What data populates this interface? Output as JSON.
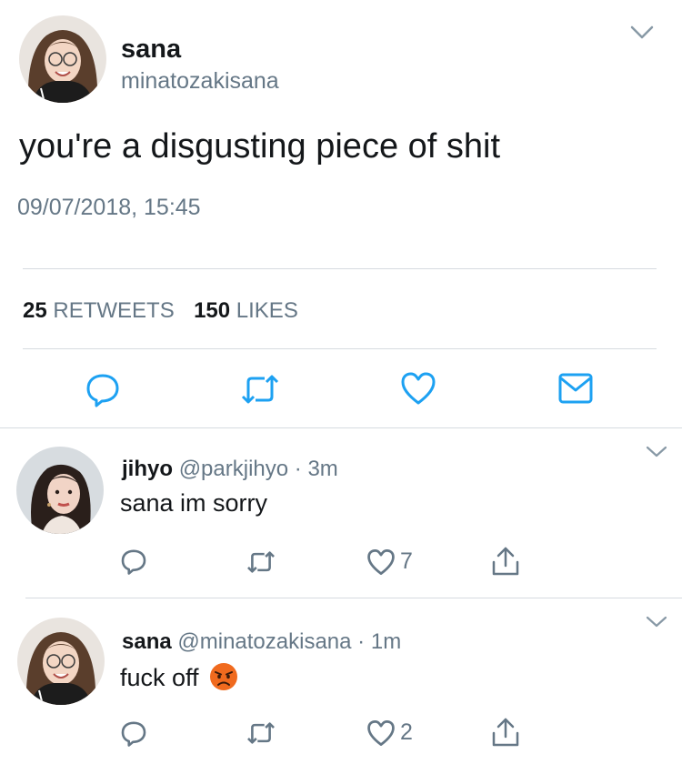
{
  "main_tweet": {
    "display_name": "sana",
    "username": "minatozakisana",
    "text": "you're a disgusting piece of shit",
    "timestamp": "09/07/2018, 15:45",
    "retweets_count": "25",
    "retweets_label": "RETWEETS",
    "likes_count": "150",
    "likes_label": "LIKES"
  },
  "replies": [
    {
      "display_name": "jihyo",
      "handle": "@parkjihyo",
      "separator": "·",
      "time": "3m",
      "text": "sana im sorry",
      "like_count": "7"
    },
    {
      "display_name": "sana",
      "handle": "@minatozakisana",
      "separator": "·",
      "time": "1m",
      "text": "fuck off",
      "emoji": "angry-face",
      "like_count": "2"
    }
  ],
  "colors": {
    "text": "#14171a",
    "secondary": "#657786",
    "divider": "#d6dbe0",
    "icon": "#1da1f2",
    "emoji": "#f06a1e"
  },
  "icons": [
    "chevron-down-icon",
    "reply-icon",
    "retweet-icon",
    "heart-icon",
    "mail-icon",
    "share-icon",
    "angry-face-emoji"
  ]
}
